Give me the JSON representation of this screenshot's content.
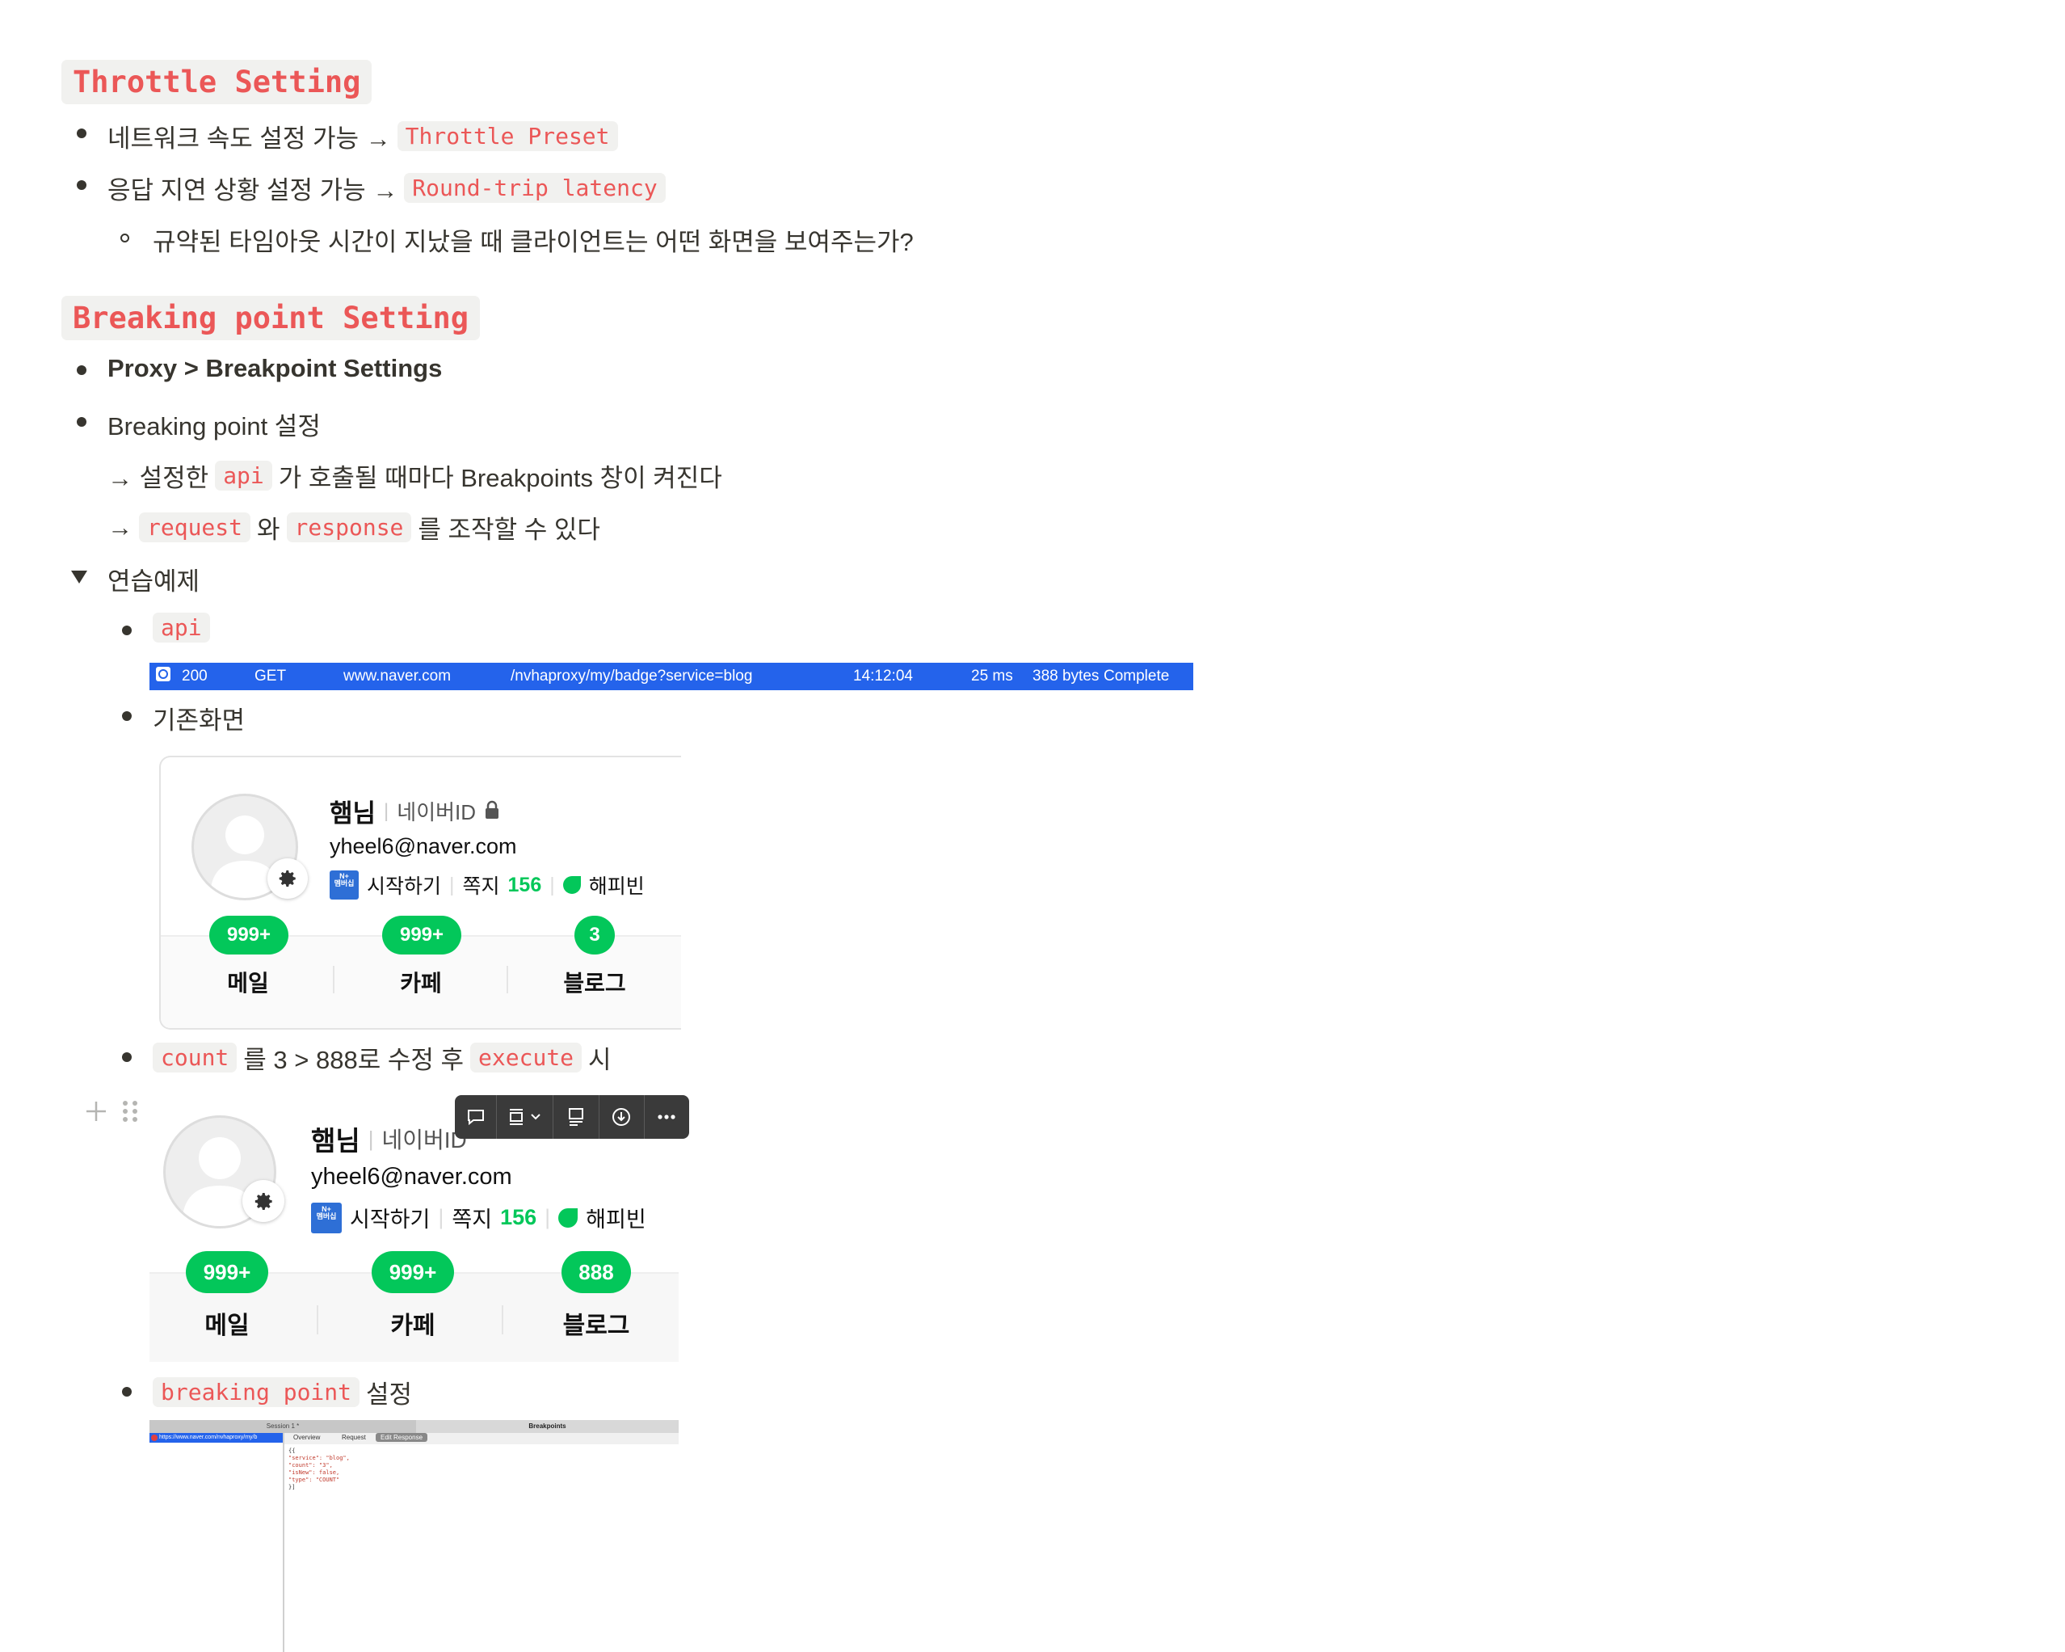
{
  "throttle": {
    "heading": "Throttle Setting",
    "item1_text": "네트워크 속도 설정 가능 →",
    "item1_code": "Throttle Preset",
    "item2_text": "응답 지연 상황 설정 가능 →",
    "item2_code": "Round-trip latency",
    "sub_item": "규약된 타임아웃 시간이 지났을 때 클라이언트는 어떤 화면을 보여주는가?"
  },
  "breaking": {
    "heading": "Breaking point Setting",
    "item1": "Proxy > Breakpoint Settings",
    "item2": "Breaking point 설정",
    "line1_pre": "→ 설정한",
    "line1_code": "api",
    "line1_post": "가 호출될 때마다 Breakpoints 창이 켜진다",
    "line2_pre": "→",
    "line2_code1": "request",
    "line2_mid": "와",
    "line2_code2": "response",
    "line2_post": "를 조작할 수 있다",
    "toggle_label": "연습예제"
  },
  "practice": {
    "api_code": "api",
    "request_row": {
      "status": "200",
      "method": "GET",
      "host": "www.naver.com",
      "path": "/nvhaproxy/my/badge?service=blog",
      "time": "14:12:04",
      "duration": "25 ms",
      "size": "388 bytes",
      "state": "Complete"
    },
    "before_label": "기존화면",
    "modify_code1": "count",
    "modify_text": "를 3 > 888로 수정 후",
    "modify_code2": "execute",
    "modify_after": "시",
    "bp_code": "breaking point",
    "bp_text": "설정"
  },
  "profile_before": {
    "name": "햄님",
    "id_label": "네이버ID",
    "email": "yheel6@naver.com",
    "membership_icon": "N+\n멤버십",
    "start_label": "시작하기",
    "note_label": "쪽지",
    "note_count": "156",
    "happybean": "해피빈",
    "badges": [
      "999+",
      "999+",
      "3"
    ],
    "labels": [
      "메일",
      "카페",
      "블로그"
    ]
  },
  "profile_after": {
    "name": "햄님",
    "id_label": "네이버ID",
    "email": "yheel6@naver.com",
    "membership_icon": "N+\n멤버십",
    "start_label": "시작하기",
    "note_label": "쪽지",
    "note_count": "156",
    "happybean": "해피빈",
    "badges": [
      "999+",
      "999+",
      "888"
    ],
    "labels": [
      "메일",
      "카페",
      "블로그"
    ]
  },
  "bp_window": {
    "left_title": "Session 1 *",
    "right_title": "Breakpoints",
    "url": "https://www.naver.com/nvhaproxy/my/b",
    "tabs": [
      "Overview",
      "Request",
      "Edit Response"
    ],
    "json_lines": [
      "{{",
      "  \"service\": \"blog\",",
      "  \"count\": \"3\",",
      "  \"isNew\": false,",
      "  \"type\": \"COUNT\"",
      "}]"
    ]
  },
  "colors": {
    "code_text": "#eb5757",
    "code_bg": "#f1f1ef",
    "request_bar": "#2463eb",
    "naver_green": "#03c75a"
  }
}
